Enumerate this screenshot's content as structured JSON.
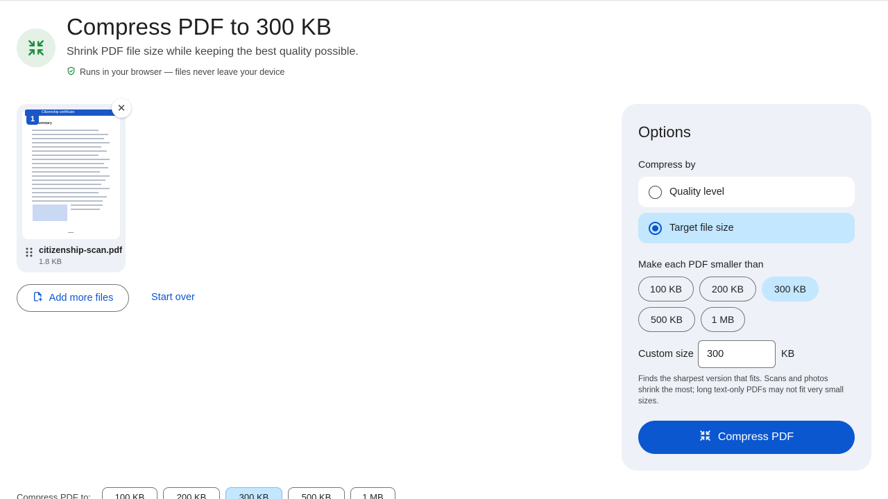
{
  "header": {
    "title": "Compress PDF to 300 KB",
    "subtitle": "Shrink PDF file size while keeping the best quality possible.",
    "privacy_note": "Runs in your browser — files never leave your device",
    "hero_icon": "compress-arrows-icon",
    "accent_color": "#1e8e3e"
  },
  "file": {
    "name": "citizenship-scan.pdf",
    "size": "1.8 KB",
    "page_number": "1",
    "thumb_title": "Citizenship certificate",
    "thumb_heading": "Summary"
  },
  "actions": {
    "add_more": "Add more files",
    "start_over": "Start over"
  },
  "options": {
    "title": "Options",
    "compress_by_label": "Compress by",
    "modes": [
      {
        "label": "Quality level",
        "selected": false
      },
      {
        "label": "Target file size",
        "selected": true
      }
    ],
    "make_smaller_label": "Make each PDF smaller than",
    "sizes": [
      {
        "label": "100 KB",
        "selected": false
      },
      {
        "label": "200 KB",
        "selected": false
      },
      {
        "label": "300 KB",
        "selected": true
      },
      {
        "label": "500 KB",
        "selected": false
      },
      {
        "label": "1 MB",
        "selected": false
      }
    ],
    "custom_label": "Custom size",
    "custom_value": "300",
    "custom_unit": "KB",
    "hint": "Finds the sharpest version that fits. Scans and photos shrink the most; long text-only PDFs may not fit very small sizes.",
    "submit": "Compress PDF"
  },
  "quick_bar": {
    "label": "Compress PDF to:",
    "sizes": [
      "100 KB",
      "200 KB",
      "300 KB",
      "500 KB",
      "1 MB"
    ],
    "selected": "300 KB"
  },
  "colors": {
    "primary": "#0b57d0",
    "selected_bg": "#c2e7ff",
    "panel_bg": "#eef1f7"
  }
}
